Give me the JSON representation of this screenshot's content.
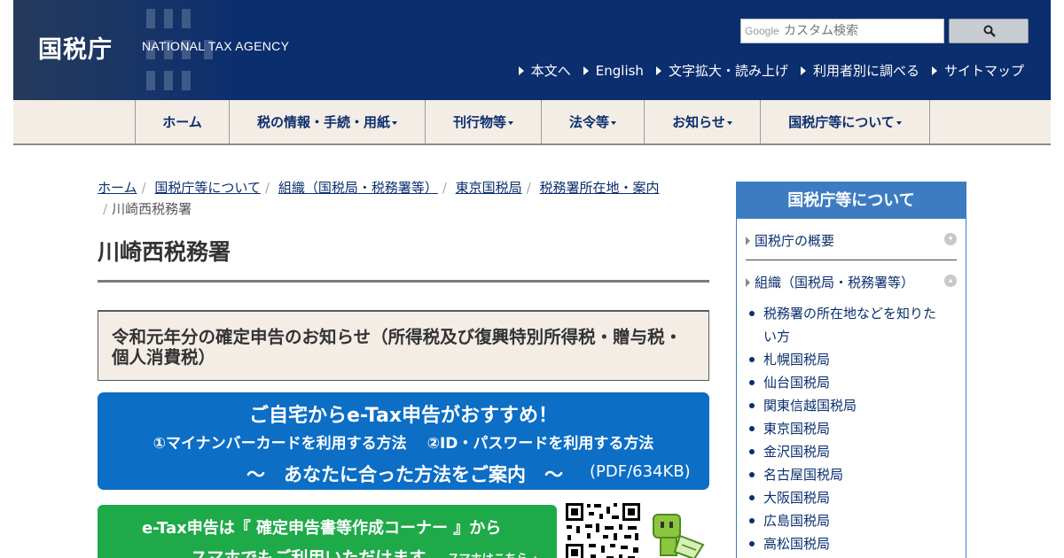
{
  "header": {
    "logo_ja": "国税庁",
    "logo_en": "NATIONAL TAX AGENCY",
    "search": {
      "brand": "Google",
      "placeholder": "カスタム検索",
      "button_icon": "search-icon"
    },
    "util_links": [
      "本文へ",
      "English",
      "文字拡大・読み上げ",
      "利用者別に調べる",
      "サイトマップ"
    ]
  },
  "global_nav": [
    {
      "label": "ホーム",
      "dropdown": false
    },
    {
      "label": "税の情報・手続・用紙",
      "dropdown": true
    },
    {
      "label": "刊行物等",
      "dropdown": true
    },
    {
      "label": "法令等",
      "dropdown": true
    },
    {
      "label": "お知らせ",
      "dropdown": true
    },
    {
      "label": "国税庁等について",
      "dropdown": true
    }
  ],
  "breadcrumb": {
    "links": [
      "ホーム",
      "国税庁等について",
      "組織（国税局・税務署等）",
      "東京国税局",
      "税務署所在地・案内"
    ],
    "current": "川崎西税務署"
  },
  "main": {
    "title": "川崎西税務署",
    "notice_title": "令和元年分の確定申告のお知らせ（所得税及び復興特別所得税・贈与税・個人消費税）",
    "etax_banner": {
      "line1": "ご自宅からe-Tax申告がおすすめ！",
      "line2": "①マイナンバーカードを利用する方法　 ②ID・パスワードを利用する方法",
      "line3": "～　あなたに合った方法をご案内　～",
      "file": "(PDF/634KB)"
    },
    "green_banner": {
      "line1": "e-Tax申告は『 確定申告書等作成コーナー 』から",
      "line2": "スマホでもご利用いただけます",
      "line3": "スマホはこちら→"
    }
  },
  "sidebar": {
    "title": "国税庁等について",
    "items": [
      "国税庁の概要",
      "組織（国税局・税務署等）"
    ],
    "sub_items": [
      "税務署の所在地などを知りたい方",
      "札幌国税局",
      "仙台国税局",
      "関東信越国税局",
      "東京国税局",
      "金沢国税局",
      "名古屋国税局",
      "大阪国税局",
      "広島国税局",
      "高松国税局"
    ]
  },
  "colors": {
    "header_bg": "#0b2e6e",
    "nav_bg": "#f3ede6",
    "etax_blue": "#0c6ec4",
    "green": "#1faa4a",
    "sidebar_blue": "#3d7cc1"
  }
}
